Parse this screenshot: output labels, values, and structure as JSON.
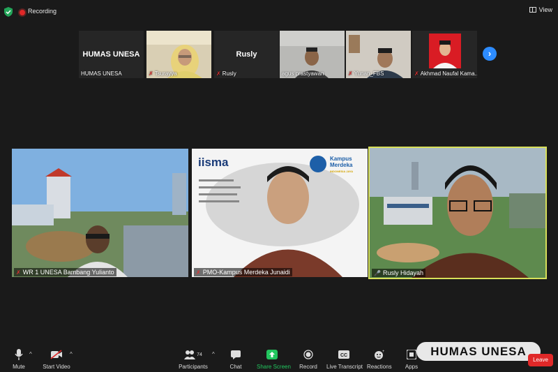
{
  "meeting": {
    "recording_label": "Recording",
    "view_label": "View"
  },
  "gallery_strip": [
    {
      "big_name": "HUMAS UNESA",
      "name": "HUMAS UNESA",
      "muted": false,
      "video": false
    },
    {
      "big_name": "",
      "name": "Tsurayya",
      "muted": true,
      "video": true
    },
    {
      "big_name": "Rusly",
      "name": "Rusly",
      "muted": true,
      "video": false
    },
    {
      "big_name": "",
      "name": "agus prastyawan",
      "muted": false,
      "video": true
    },
    {
      "big_name": "",
      "name": "Yunan_FBS",
      "muted": true,
      "video": true
    },
    {
      "big_name": "",
      "name": "Akhmad Naufal Kama...",
      "muted": true,
      "video": true
    }
  ],
  "main_tiles": [
    {
      "name": "WR 1 UNESA Bambang Yulianto",
      "muted": true,
      "active": false
    },
    {
      "name": "PMO-Kampus Merdeka Junaidi",
      "muted": true,
      "active": false
    },
    {
      "name": "Rusly Hidayah",
      "muted": false,
      "active": true
    }
  ],
  "slide": {
    "logo": "iisma",
    "brand": "Kampus Merdeka",
    "brand_sub": "INDONESIA JAYA"
  },
  "toolbar": {
    "mute": "Mute",
    "start_video": "Start Video",
    "participants": "Participants",
    "participants_count": "74",
    "chat": "Chat",
    "share_screen": "Share Screen",
    "record": "Record",
    "live_transcript": "Live Transcript",
    "reactions": "Reactions",
    "apps": "Apps",
    "leave": "Leave"
  },
  "watermark": "HUMAS UNESA",
  "colors": {
    "background": "#1a1a1a",
    "share_green": "#22c55e",
    "leave_red": "#e02828",
    "active_speaker": "#d8e05a",
    "accent_blue": "#2d8cff"
  }
}
